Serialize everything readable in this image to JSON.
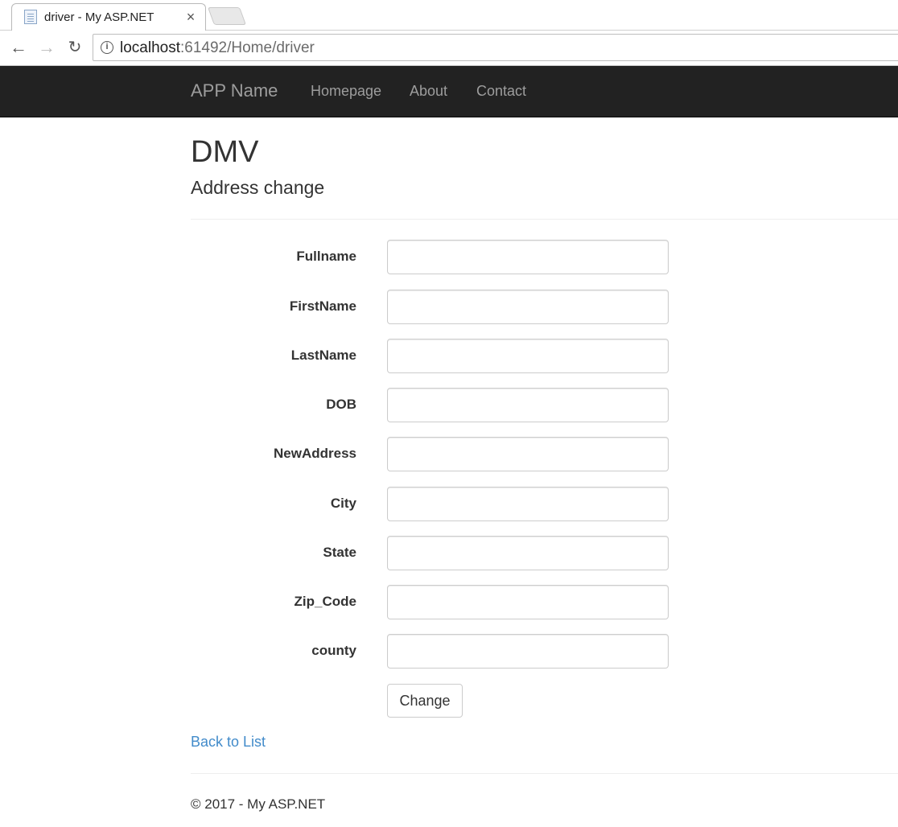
{
  "browser": {
    "tab_title": "driver - My ASP.NET",
    "tab_close": "×",
    "url_host": "localhost",
    "url_rest": ":61492/Home/driver",
    "back_glyph": "←",
    "forward_glyph": "→",
    "reload_glyph": "↻",
    "info_glyph": "i"
  },
  "navbar": {
    "brand": "APP Name",
    "links": [
      "Homepage",
      "About",
      "Contact"
    ]
  },
  "page": {
    "title": "DMV",
    "subtitle": "Address change"
  },
  "form": {
    "fields": [
      {
        "label": "Fullname",
        "value": ""
      },
      {
        "label": "FirstName",
        "value": ""
      },
      {
        "label": "LastName",
        "value": ""
      },
      {
        "label": "DOB",
        "value": ""
      },
      {
        "label": "NewAddress",
        "value": ""
      },
      {
        "label": "City",
        "value": ""
      },
      {
        "label": "State",
        "value": ""
      },
      {
        "label": "Zip_Code",
        "value": ""
      },
      {
        "label": "county",
        "value": ""
      }
    ],
    "submit_label": "Change"
  },
  "links": {
    "back_to_list": "Back to List"
  },
  "footer": {
    "text": "© 2017 - My ASP.NET"
  },
  "colors": {
    "navbar_bg": "#222222",
    "nav_text": "#9d9d9d",
    "link": "#428bca"
  }
}
